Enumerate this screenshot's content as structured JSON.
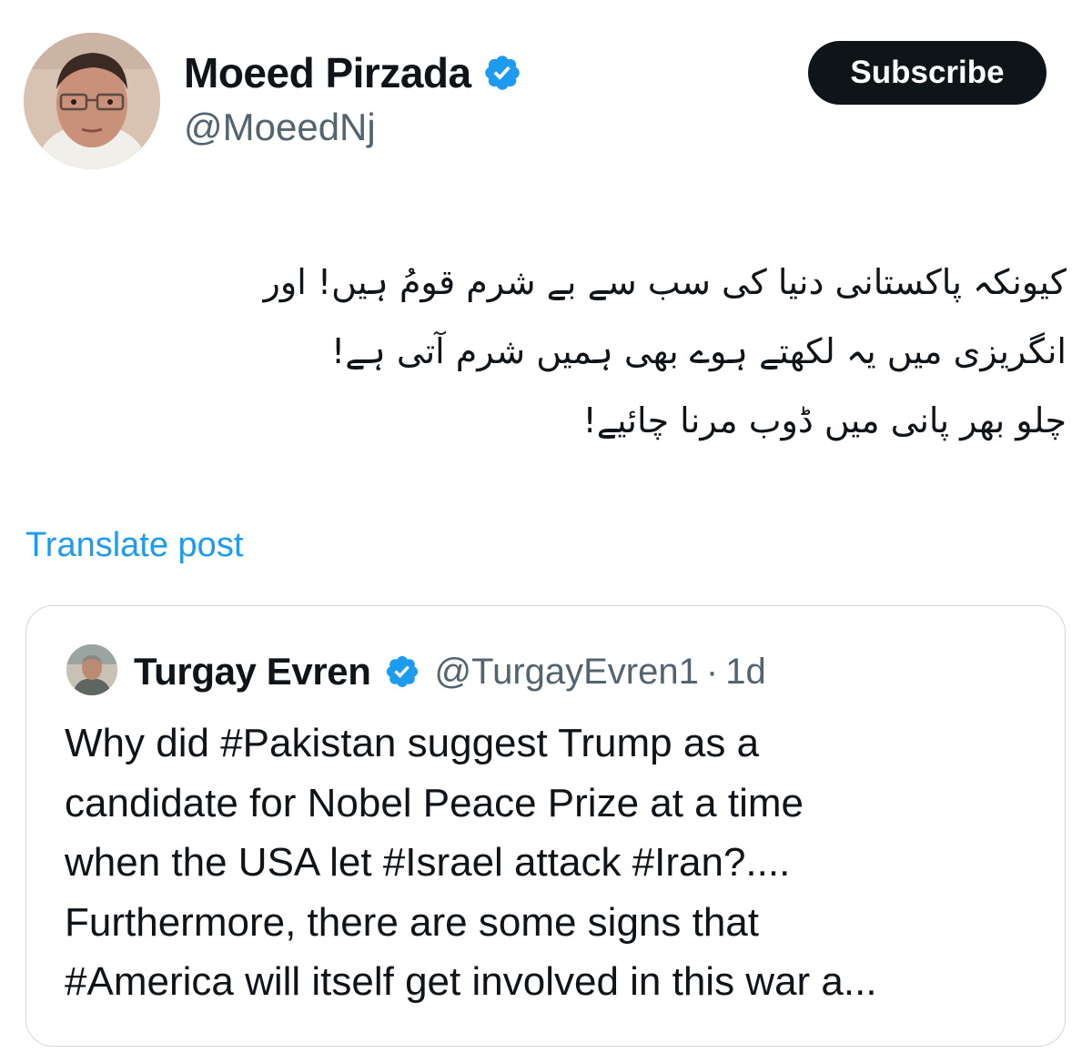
{
  "post": {
    "author": {
      "name": "Moeed Pirzada",
      "handle": "@MoeedNj",
      "verified": true,
      "avatar_icon": "profile-photo"
    },
    "subscribe_label": "Subscribe",
    "text_lines": [
      "کیونکہ پاکستانی دنیا کی سب سے بے شرم قومُ ہیں! اور",
      "انگریزی میں یہ لکھتے ہوے بھی ہمیں شرم آتی ہے!",
      "چلو بھر پانی میں ڈوب مرنا چائیے!"
    ],
    "translate_label": "Translate post"
  },
  "quote": {
    "author": {
      "name": "Turgay Evren",
      "handle": "@TurgayEvren1",
      "verified": true,
      "avatar_icon": "profile-photo"
    },
    "separator": "·",
    "time": "1d",
    "text_lines": [
      "Why did #Pakistan suggest Trump as a",
      "candidate for Nobel Peace Prize at a time",
      "when the USA let #Israel attack #Iran?....",
      "Furthermore, there are some signs that",
      "#America will itself get involved in this war a..."
    ]
  },
  "colors": {
    "text_primary": "#0f1419",
    "text_secondary": "#536471",
    "link": "#1d9bf0",
    "verified_badge": "#1d9bf0",
    "subscribe_bg": "#0f1419",
    "card_border": "#cfd9de"
  }
}
